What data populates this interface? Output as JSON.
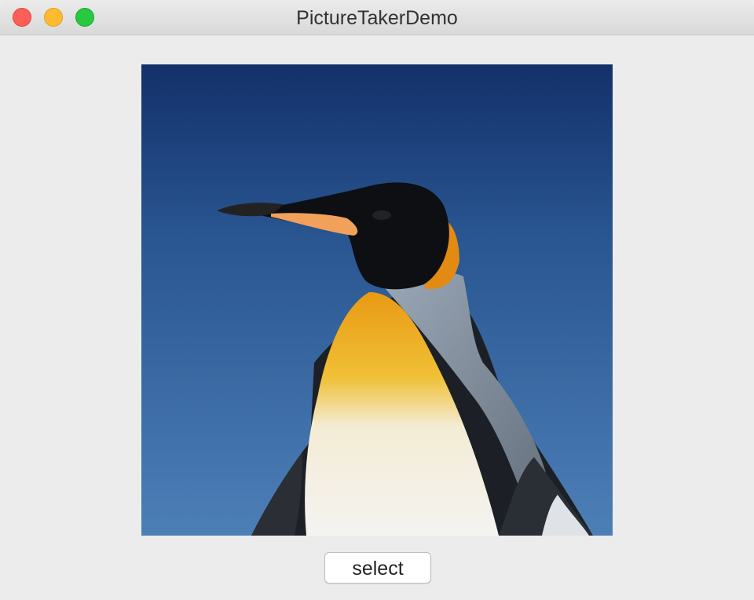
{
  "window": {
    "title": "PictureTakerDemo"
  },
  "controls": {
    "close": "close-button",
    "minimize": "minimize-button",
    "zoom": "zoom-button"
  },
  "image": {
    "subject": "emperor penguin photo"
  },
  "select_button": {
    "label": "select"
  },
  "colors": {
    "close": "#fc5f57",
    "minimize": "#fdbc2e",
    "zoom": "#28c840",
    "window_bg": "#ececec",
    "sky": "#2a5a93"
  }
}
